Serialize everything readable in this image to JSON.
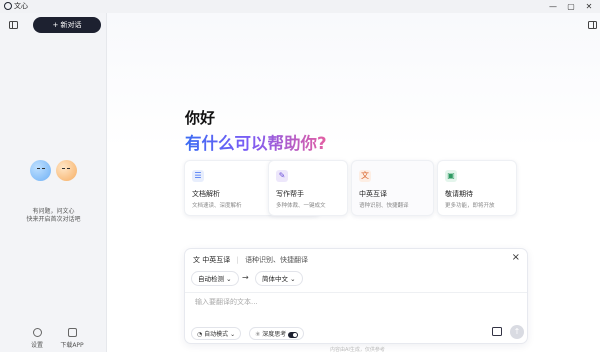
{
  "app": {
    "title": "文心"
  },
  "window_controls": [
    "—",
    "▢",
    "✕"
  ],
  "sidebar": {
    "new_chat": "+ 新对话",
    "hint_line1": "有问题，问文心",
    "hint_line2": "快来开启首次对话吧",
    "bottom": [
      {
        "label": "设置",
        "icon": "gear-icon"
      },
      {
        "label": "下载APP",
        "icon": "download-app-icon"
      }
    ]
  },
  "main": {
    "greeting": "你好",
    "headline": "有什么可以帮助你?",
    "cards": [
      {
        "title": "文档解析",
        "desc": "文档速读、深度解析",
        "icon": "document-icon",
        "glyph": "☰"
      },
      {
        "title": "写作帮手",
        "desc": "多种体裁、一键成文",
        "icon": "pen-icon",
        "glyph": "✎"
      },
      {
        "title": "中英互译",
        "desc": "语种识别、快捷翻译",
        "icon": "translate-icon",
        "glyph": "文"
      },
      {
        "title": "敬请期待",
        "desc": "更多功能，即将开放",
        "icon": "image-icon",
        "glyph": "▣"
      }
    ]
  },
  "composer": {
    "mode_title": "中英互译",
    "mode_sub": "语种识别、快捷翻译",
    "source_lang": "自动检测",
    "target_lang": "简体中文",
    "placeholder": "输入要翻译的文本...",
    "auto_mode": "自动模式",
    "deep_think": "深度思考"
  },
  "footer": {
    "text": "内容由AI生成，仅供参考"
  },
  "colors": {
    "accent": "#1d2130",
    "gradient_start": "#3b6cf3",
    "gradient_end": "#e45fa2"
  }
}
